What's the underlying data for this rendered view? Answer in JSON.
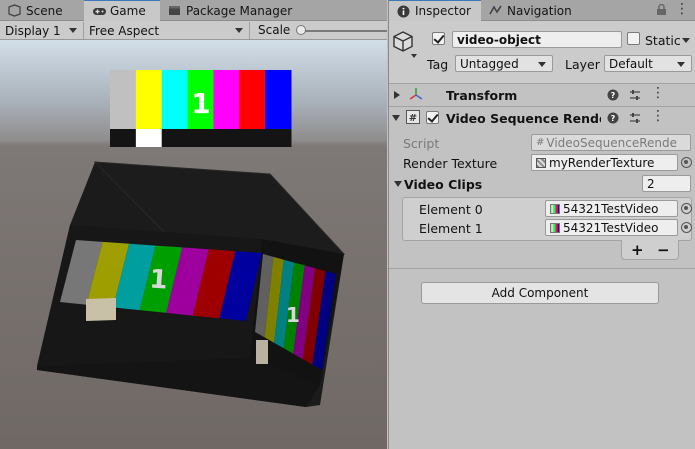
{
  "tabs_left": [
    {
      "label": "Scene",
      "icon": "scene-icon"
    },
    {
      "label": "Game",
      "icon": "game-controller-icon"
    },
    {
      "label": "Package Manager",
      "icon": "package-icon"
    }
  ],
  "game_toolbar": {
    "display": "Display 1",
    "aspect": "Free Aspect",
    "scale_label": "Scale"
  },
  "test_card": {
    "number": "1",
    "bar_colors": [
      "#c0c0c0",
      "#ffff00",
      "#00ffff",
      "#00ff00",
      "#ff00ff",
      "#ff0000",
      "#0000ff"
    ],
    "bottom_colors": [
      "#141414",
      "#ffffff",
      "#141414",
      "#141414",
      "#141414",
      "#141414",
      "#141414"
    ]
  },
  "tabs_right": [
    {
      "label": "Inspector",
      "icon": "info-icon"
    },
    {
      "label": "Navigation",
      "icon": "navigation-icon"
    }
  ],
  "inspector": {
    "object_name": "video-object",
    "static_label": "Static",
    "tag_label": "Tag",
    "tag_value": "Untagged",
    "layer_label": "Layer",
    "layer_value": "Default",
    "components": [
      {
        "title": "Transform"
      },
      {
        "title": "Video Sequence Render Textu"
      }
    ],
    "script_label": "Script",
    "script_value": "VideoSequenceRende",
    "render_texture_label": "Render Texture",
    "render_texture_value": "myRenderTexture",
    "video_clips_label": "Video Clips",
    "video_clips_count": "2",
    "elements": [
      {
        "label": "Element 0",
        "value": "54321TestVideo"
      },
      {
        "label": "Element 1",
        "value": "54321TestVideo"
      }
    ],
    "plus": "+",
    "minus": "−",
    "add_component": "Add Component"
  }
}
